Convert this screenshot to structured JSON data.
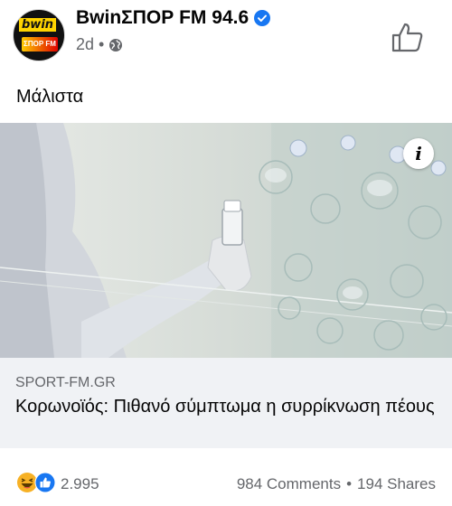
{
  "post": {
    "page_name": "BwinΣΠΟΡ FM 94.6",
    "time": "2d",
    "separator": "•",
    "text": "Μάλιστα"
  },
  "avatar": {
    "logo_text": "bwin",
    "logo_sub": "ΣΠΟΡ FM"
  },
  "link": {
    "domain": "SPORT-FM.GR",
    "title": "Κορωνοϊός: Πιθανό σύμπτωμα η συρρίκνωση πέους",
    "info_label": "i"
  },
  "reactions": {
    "count": "2.995",
    "comments": "984 Comments",
    "shares": "194 Shares",
    "separator": "•",
    "types": [
      "haha",
      "like"
    ]
  },
  "icons": {
    "verified": "verified-badge-icon",
    "globe": "globe-icon",
    "like_page": "thumbs-up-icon"
  },
  "colors": {
    "verified_blue": "#1877f2",
    "like_blue": "#1877f2",
    "haha_yellow": "#f7b125",
    "link_bg": "#f0f2f5",
    "secondary_text": "#65676b"
  }
}
